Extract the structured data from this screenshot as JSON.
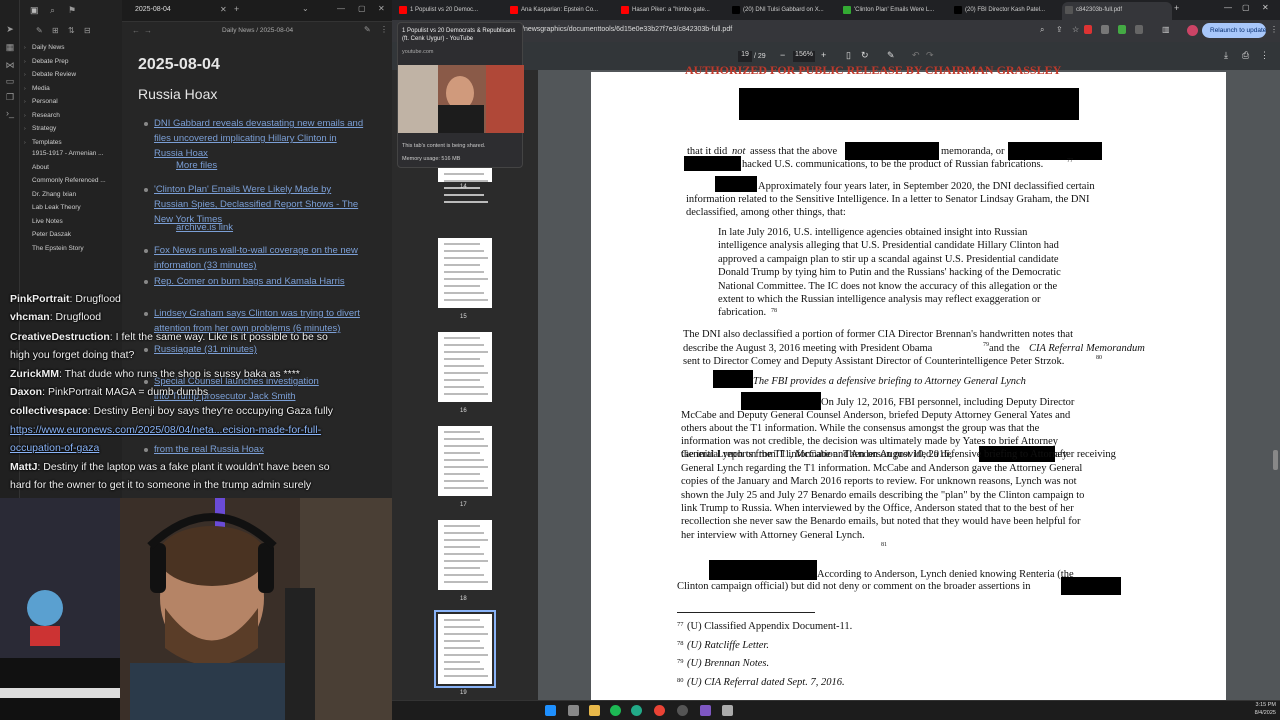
{
  "obsidian": {
    "tab_title": "2025-08-04",
    "breadcrumb": "Daily News / 2025-08-04",
    "sidebar": [
      "Daily News",
      "Debate Prep",
      "Debate Review",
      "Media",
      "Personal",
      "Research",
      "Strategy",
      "Templates",
      "1915-1917 - Armenian ...",
      "About",
      "Commonly Referenced ...",
      "Dr. Zhang Ixian",
      "Lab Leak Theory",
      "Live Notes",
      "Peter Daszak",
      "The Epstein Story"
    ],
    "note_title": "2025-08-04",
    "heading": "Russia Hoax",
    "links": [
      {
        "l1": "DNI Gabbard reveals devastating new emails and",
        "l2": "files uncovered implicating Hillary Clinton in",
        "l3": "Russia Hoax"
      },
      {
        "sub": "More files"
      },
      {
        "l1": "'Clinton Plan' Emails Were Likely Made by",
        "l2": "Russian Spies, Declassified Report Shows - The",
        "l3": "New York Times"
      },
      {
        "sub": "archive.is link"
      },
      {
        "l1": "Fox News runs wall-to-wall coverage on the new",
        "l2": "information (33 minutes)"
      },
      {
        "l1": "Rep. Comer on burn bags and Kamala Harris"
      },
      {
        "l1": "Lindsey Graham says Clinton was trying to divert",
        "l2": "attention from her own problems (6 minutes)"
      },
      {
        "l1": "Russiagate (31 minutes)"
      },
      {
        "l1": "Special Counsel launches investigation",
        "l2": "into Trump prosecutor Jack Smith"
      },
      {
        "l1": "from the real Russia Hoax"
      }
    ]
  },
  "chat": [
    {
      "user": "PinkPortrait",
      "msg": "Drugflood"
    },
    {
      "user": "vhcman",
      "msg": "Drugflood"
    },
    {
      "user": "CreativeDestruction",
      "msg": "I felt the same way. Like is it possible to be so"
    },
    {
      "user": "",
      "msg": "high you forget doing that?"
    },
    {
      "user": "ZurickMM",
      "msg": "That dude who runs the shop is sussy baka as ****"
    },
    {
      "user": "Daxon",
      "msg": "PinkPortrait MAGA = dumb dumbs"
    },
    {
      "user": "collectivespace",
      "msg": "Destiny Benji boy says they're occupying Gaza fully"
    },
    {
      "user": "",
      "link": "https://www.euronews.com/2025/08/04/neta...ecision-made-for-full-"
    },
    {
      "user": "",
      "link": "occupation-of-gaza"
    },
    {
      "user": "MattJ",
      "msg": "Destiny if the laptop was a fake plant it wouldn't have been so"
    },
    {
      "user": "",
      "msg": "hard for the owner to get it to someone in the trump admin surely"
    }
  ],
  "browser": {
    "tabs": [
      "1 Populist vs 20 Democ...",
      "Ana Kasparian: Epstein Co...",
      "Hasan Piker: a \"himbo gate...",
      "(20) DNI Tulsi Gabbard on X...",
      "'Clinton Plan' Emails Were L...",
      "(20) FBI Director Kash Patel...",
      "c842303b-full.pdf"
    ],
    "url": "/newsgraphics/documenttools/6d15e0e33b27f7e3/c842303b-full.pdf",
    "relaunch": "Relaunch to update",
    "page_current": "19",
    "page_total": "/ 29",
    "zoom": "156%",
    "popup_title": "1 Populist vs 20 Democrats & Republicans (ft. Cenk Uygur) - YouTube",
    "popup_domain": "youtube.com",
    "popup_sharing": "This tab's content is being shared.",
    "popup_memory": "Memory usage: 516 MB",
    "thumb_nums": [
      "14",
      "15",
      "16",
      "17",
      "18",
      "19"
    ]
  },
  "pdf": {
    "top_heading": "AUTHORIZED FOR PUBLIC RELEASE BY CHAIRMAN GRASSLEY",
    "p1a": "that it did",
    "p1b": "not",
    "p1c": "assess that the above",
    "p1d": "memoranda, or",
    "p1e": "hacked U.S. communications, to be the product of Russian fabrications.",
    "p2": [
      "Approximately four years later, in September 2020, the DNI declassified certain",
      "information related to the Sensitive Intelligence.  In a letter to Senator Lindsay Graham, the DNI",
      "declassified, among other things, that:"
    ],
    "quote": [
      "In late July 2016, U.S. intelligence agencies obtained insight into Russian",
      "intelligence analysis alleging that U.S. Presidential candidate Hillary Clinton had",
      "approved a campaign plan to stir up a scandal against U.S. Presidential candidate",
      "Donald Trump by tying him to Putin and the Russians' hacking of the Democratic",
      "National Committee. The IC does not know the accuracy of this allegation or the",
      "extent to which the Russian intelligence analysis may reflect exaggeration or",
      "fabrication."
    ],
    "p3": [
      "The DNI also declassified a portion of former CIA Director Brennan's handwritten notes that",
      "describe the August 3, 2016 meeting with President Obama",
      "and the",
      "CIA Referral Memorandum",
      "sent to Director Comey and Deputy Assistant Director of Counterintelligence Peter Strzok."
    ],
    "subhead": "The FBI provides a defensive briefing to Attorney General Lynch",
    "p4": [
      "On July 12, 2016, FBI personnel, including Deputy Director",
      "McCabe and Deputy General Counsel Anderson, briefed Deputy Attorney General Yates and",
      "others about the T1 information.  While the consensus amongst the group was that the",
      "information was not credible, the decision was ultimately made by Yates to brief Attorney",
      "General Lynch on the T1 information.  Then on August 10, 2016,",
      "after receiving",
      "the initial reports from T1, McCabe and Anderson provided a defensive briefing to Attorney",
      "General Lynch regarding the T1 information.  McCabe and Anderson gave the Attorney General",
      "copies of the January and March 2016 reports to review.  For unknown reasons, Lynch was not",
      "shown the July 25 and July 27 Benardo emails describing the \"plan\" by the Clinton campaign to",
      "link Trump to Russia.  When interviewed by the Office, Anderson stated that to the best of her",
      "recollection she never saw the Benardo emails, but noted that they would have been helpful for",
      "her interview with Attorney General Lynch."
    ],
    "p5": [
      "According to Anderson, Lynch denied knowing Renteria (the",
      "Clinton campaign official) but did not deny or comment on the broader assertions in"
    ],
    "fn": [
      {
        "n": "77",
        "t": "(U) Classified Appendix Document-11."
      },
      {
        "n": "78",
        "t": "(U) Ratcliffe Letter."
      },
      {
        "n": "79",
        "t": "(U) Brennan Notes."
      },
      {
        "n": "80",
        "t": "(U) CIA Referral dated Sept. 7, 2016."
      }
    ],
    "sup": {
      "a": "77",
      "b": "78",
      "c": "79",
      "d": "80",
      "e": "81"
    }
  },
  "system": {
    "time": "3:15 PM",
    "date": "8/4/2025"
  }
}
